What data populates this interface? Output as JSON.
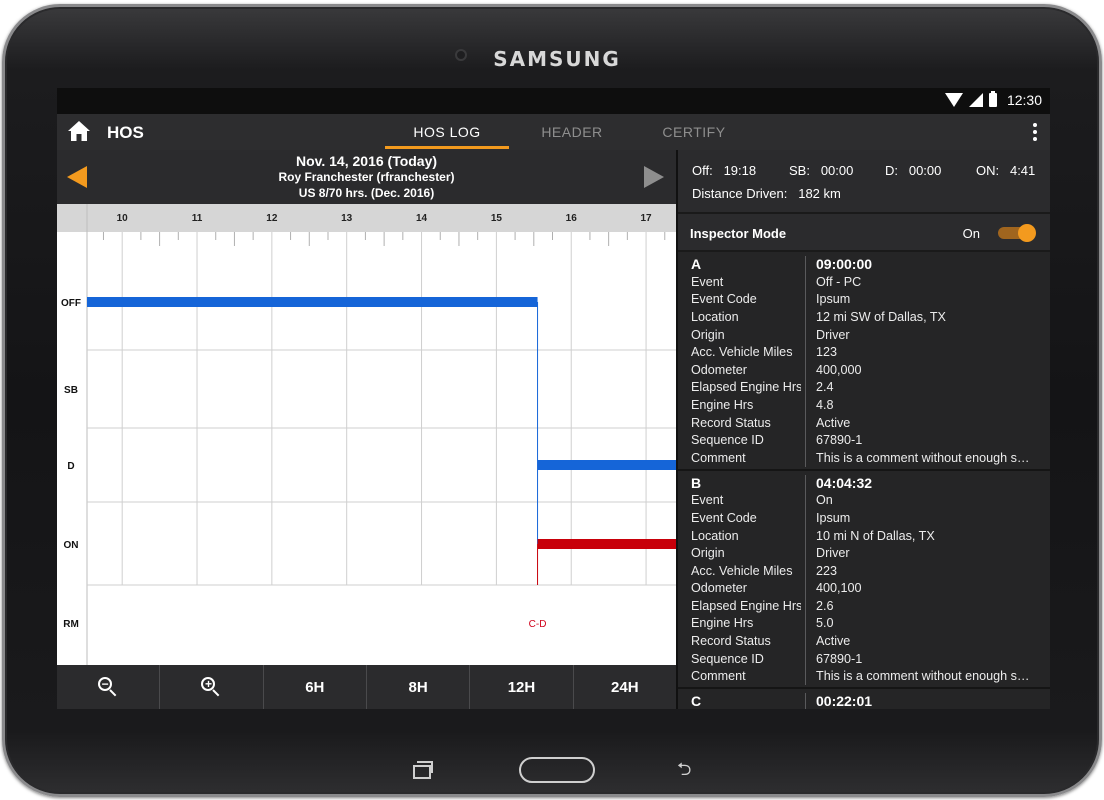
{
  "device": {
    "brand": "SAMSUNG"
  },
  "status_bar": {
    "time": "12:30"
  },
  "app_bar": {
    "title": "HOS",
    "tabs": [
      {
        "label": "HOS LOG",
        "active": true
      },
      {
        "label": "HEADER",
        "active": false
      },
      {
        "label": "CERTIFY",
        "active": false
      }
    ]
  },
  "log_header": {
    "date": "Nov. 14, 2016 (Today)",
    "driver": "Roy Franchester (rfranchester)",
    "rule": "US 8/70 hrs. (Dec. 2016)"
  },
  "chart_data": {
    "type": "line",
    "x": {
      "ticks": [
        "10",
        "11",
        "12",
        "13",
        "14",
        "15",
        "16",
        "17"
      ],
      "range": [
        9.53,
        17.4
      ]
    },
    "rows": [
      "OFF",
      "SB",
      "D",
      "ON",
      "RM"
    ],
    "series": [
      {
        "status": "OFF",
        "start": 9.53,
        "end": 15.55,
        "color": "#1565d8"
      },
      {
        "status": "D",
        "start": 15.55,
        "end": 17.4,
        "color": "#1565d8"
      },
      {
        "status": "ON",
        "start": 15.55,
        "end": 17.4,
        "color": "#c8000a"
      }
    ],
    "transition_x": 15.55,
    "annotations": [
      {
        "label": "C-D",
        "x": 15.55,
        "row": "RM",
        "color": "#d0021b"
      }
    ]
  },
  "controls": {
    "zoom_out": "zoom-out",
    "zoom_in": "zoom-in",
    "h6": "6H",
    "h8": "8H",
    "h12": "12H",
    "h24": "24H"
  },
  "summary": {
    "off_label": "Off:",
    "off": "19:18",
    "sb_label": "SB:",
    "sb": "00:00",
    "d_label": "D:",
    "d": "00:00",
    "on_label": "ON:",
    "on": "4:41",
    "distance_label": "Distance Driven:",
    "distance": "182 km"
  },
  "inspector": {
    "label": "Inspector Mode",
    "state": "On",
    "enabled": true,
    "accent": "#f39a1e"
  },
  "events": [
    {
      "id": "A",
      "time": "09:00:00",
      "fields": [
        {
          "k": "Event",
          "v": "Off - PC"
        },
        {
          "k": "Event Code",
          "v": "Ipsum"
        },
        {
          "k": "Location",
          "v": "12 mi SW of Dallas, TX"
        },
        {
          "k": "Origin",
          "v": "Driver"
        },
        {
          "k": "Acc. Vehicle Miles",
          "v": "123"
        },
        {
          "k": "Odometer",
          "v": "400,000"
        },
        {
          "k": "Elapsed Engine Hrs",
          "v": "2.4"
        },
        {
          "k": "Engine Hrs",
          "v": "4.8"
        },
        {
          "k": "Record Status",
          "v": "Active"
        },
        {
          "k": "Sequence ID",
          "v": "67890-1"
        },
        {
          "k": "Comment",
          "v": "This is a comment without enough sp..."
        }
      ]
    },
    {
      "id": "B",
      "time": "04:04:32",
      "fields": [
        {
          "k": "Event",
          "v": "On"
        },
        {
          "k": "Event Code",
          "v": "Ipsum"
        },
        {
          "k": "Location",
          "v": "10 mi N of Dallas, TX"
        },
        {
          "k": "Origin",
          "v": "Driver"
        },
        {
          "k": "Acc. Vehicle Miles",
          "v": "223"
        },
        {
          "k": "Odometer",
          "v": "400,100"
        },
        {
          "k": "Elapsed Engine Hrs",
          "v": "2.6"
        },
        {
          "k": "Engine Hrs",
          "v": "5.0"
        },
        {
          "k": "Record Status",
          "v": "Active"
        },
        {
          "k": "Sequence ID",
          "v": "67890-1"
        },
        {
          "k": "Comment",
          "v": "This is a comment without enough sp..."
        }
      ]
    },
    {
      "id": "C",
      "time": "00:22:01",
      "fields": []
    }
  ]
}
